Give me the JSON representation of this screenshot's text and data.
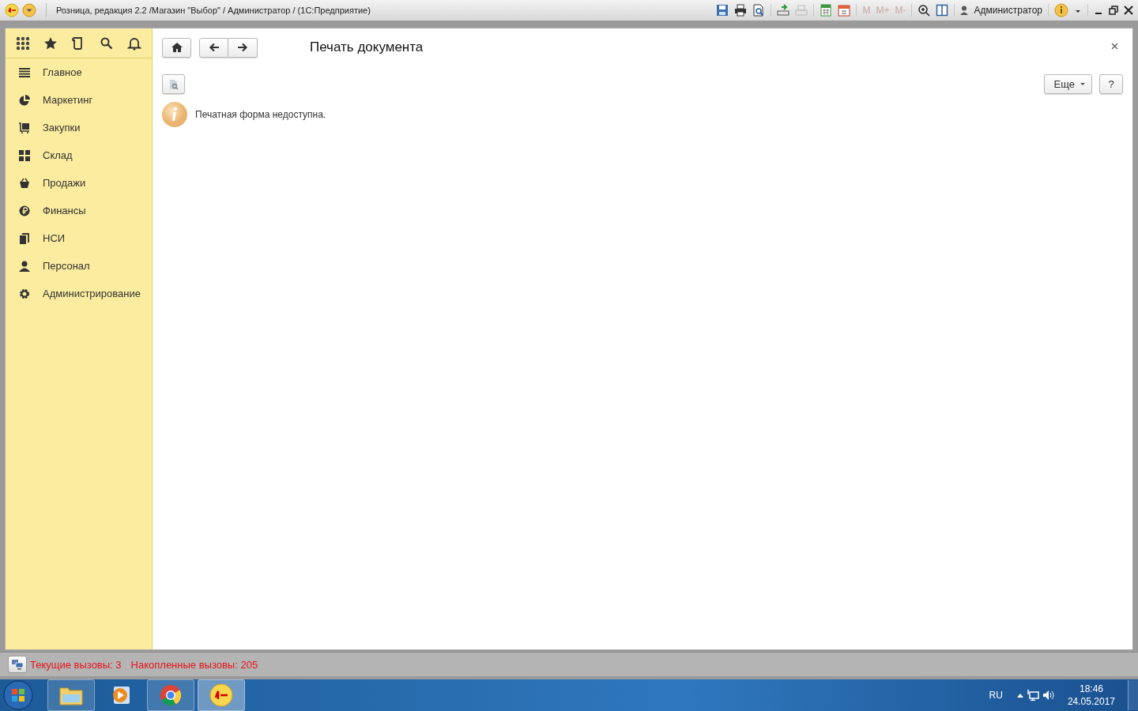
{
  "window": {
    "title": "Розница, редакция 2.2 /Магазин \"Выбор\" / Администратор /  (1С:Предприятие)",
    "user": "Администратор",
    "memory_buttons": [
      "M",
      "M+",
      "M-"
    ]
  },
  "sidebar": {
    "items": [
      {
        "label": "Главное",
        "kind": "list"
      },
      {
        "label": "Маркетинг",
        "kind": "pie"
      },
      {
        "label": "Закупки",
        "kind": "cart"
      },
      {
        "label": "Склад",
        "kind": "grid"
      },
      {
        "label": "Продажи",
        "kind": "basket"
      },
      {
        "label": "Финансы",
        "kind": "coin"
      },
      {
        "label": "НСИ",
        "kind": "books"
      },
      {
        "label": "Персонал",
        "kind": "person"
      },
      {
        "label": "Администрирование",
        "kind": "gear"
      }
    ]
  },
  "form": {
    "title": "Печать документа",
    "more_button": "Еще",
    "help_button": "?",
    "message": "Печатная форма недоступна."
  },
  "status_bar": {
    "current_calls": "Текущие вызовы: 3",
    "accumulated_calls": "Накопленные вызовы: 205"
  },
  "taskbar": {
    "language": "RU",
    "time": "18:46",
    "date": "24.05.2017"
  }
}
